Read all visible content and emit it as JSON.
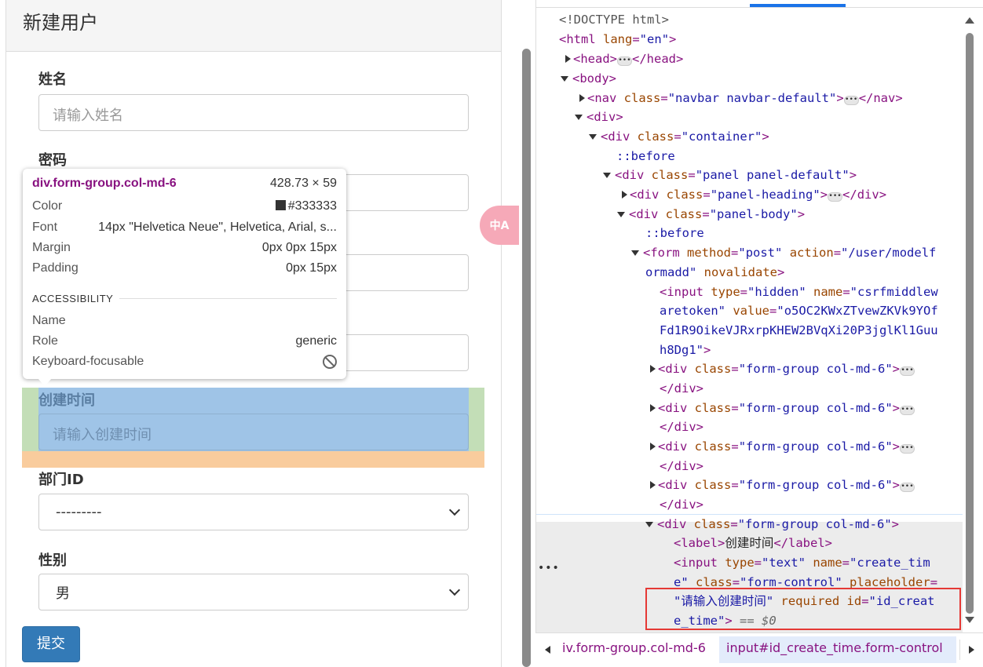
{
  "page": {
    "panel_title": "新建用户",
    "fields": [
      {
        "label": "姓名",
        "placeholder": "请输入姓名"
      },
      {
        "label": "密码",
        "placeholder": ""
      },
      {
        "label": "",
        "placeholder": ""
      },
      {
        "label": "",
        "placeholder": ""
      },
      {
        "label": "创建时间",
        "placeholder": "请输入创建时间"
      },
      {
        "label": "部门ID",
        "value": "---------"
      },
      {
        "label": "性别",
        "value": "男"
      }
    ],
    "submit_label": "提交",
    "translate_label": "中A"
  },
  "tooltip": {
    "selector": "div.form-group.col-md-6",
    "dimensions": "428.73 × 59",
    "rows": [
      {
        "key": "Color",
        "value": "#333333"
      },
      {
        "key": "Font",
        "value": "14px \"Helvetica Neue\", Helvetica, Arial, s..."
      },
      {
        "key": "Margin",
        "value": "0px 0px 15px"
      },
      {
        "key": "Padding",
        "value": "0px 15px"
      }
    ],
    "section": "ACCESSIBILITY",
    "a11y": [
      {
        "key": "Name",
        "value": ""
      },
      {
        "key": "Role",
        "value": "generic"
      },
      {
        "key": "Keyboard-focusable",
        "value": ""
      }
    ],
    "swatch_color": "#333333"
  },
  "devtools": {
    "doctype": "<!DOCTYPE html>",
    "html_lang": "en",
    "nav_class": "navbar navbar-default",
    "container_class": "container",
    "before": "::before",
    "panel_class": "panel panel-default",
    "heading_class": "panel-heading",
    "body_class": "panel-body",
    "form_method": "post",
    "form_action_1": "\"/user/modelf",
    "form_action_2": "ormadd\"",
    "novalidate": "novalidate",
    "input_hidden": {
      "type": "\"hidden\"",
      "name_1": "\"csrfmiddlew",
      "name_2": "aretoken\"",
      "value_1": "\"o5OC2KWxZTvewZKVk9YOf",
      "value_2": "Fd1R9OikeVJRxrpKHEW2BVqXi20P3jglKl1Guu",
      "value_3": "h8Dg1\""
    },
    "fg_class": "\"form-group col-md-6\"",
    "label_text": "创建时间",
    "input_type": "\"text\"",
    "input_name_1": "\"create_tim",
    "input_name_2": "e\"",
    "input_class": "\"form-control\"",
    "input_placeholder": "\"请输入创建时间\"",
    "required": "required",
    "input_id_1": "\"id_creat",
    "input_id_2": "e_time\"",
    "dollar0": "== $0",
    "crumb1": "iv.form-group.col-md-6",
    "crumb2": "input#id_create_time.form-control"
  }
}
